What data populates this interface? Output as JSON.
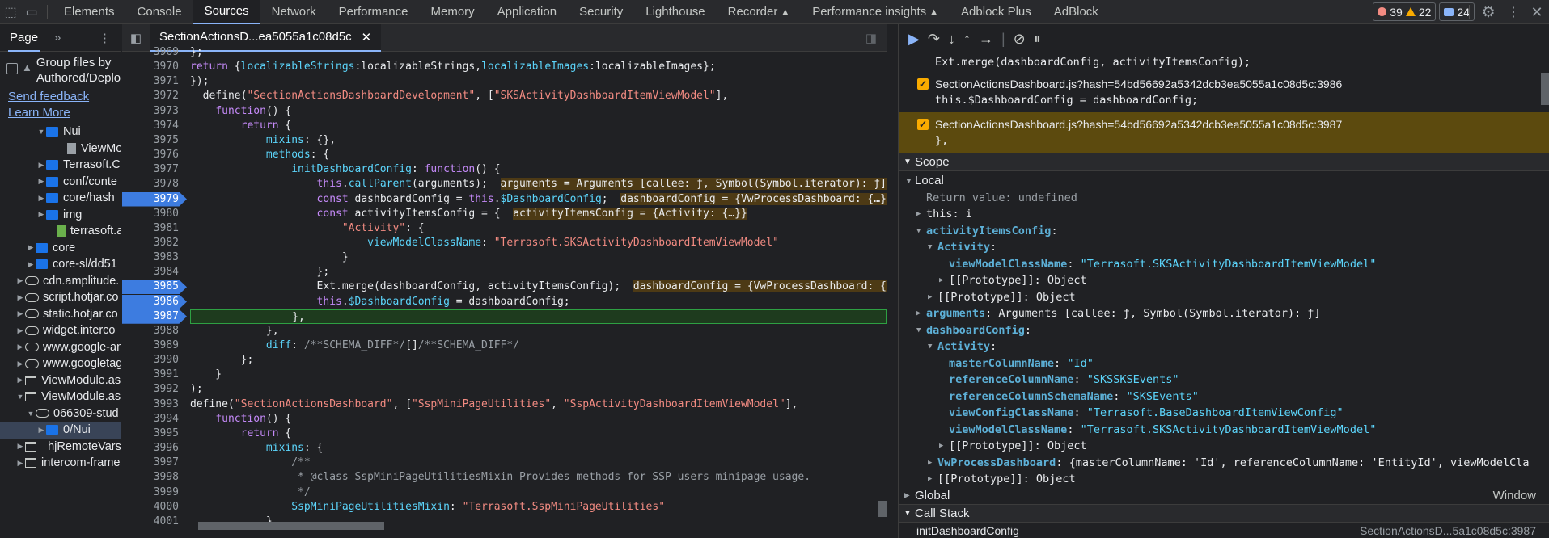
{
  "topbar": {
    "tabs": [
      "Elements",
      "Console",
      "Sources",
      "Network",
      "Performance",
      "Memory",
      "Application",
      "Security",
      "Lighthouse",
      "Recorder",
      "Performance insights",
      "Adblock Plus",
      "AdBlock"
    ],
    "active_tab": "Sources",
    "errors": "39",
    "warnings": "22",
    "messages": "24"
  },
  "left": {
    "tab": "Page",
    "group_label": "Group files by Authored/Deployed",
    "send_feedback": "Send feedback",
    "learn_more": "Learn More",
    "tree": [
      {
        "label": "Nui",
        "icon": "folder",
        "indent": 3,
        "arrow": "open"
      },
      {
        "label": "ViewModule.aspx",
        "icon": "file",
        "indent": 5,
        "arrow": ""
      },
      {
        "label": "Terrasoft.C",
        "icon": "folder",
        "indent": 3,
        "arrow": "closed"
      },
      {
        "label": "conf/conte",
        "icon": "folder",
        "indent": 3,
        "arrow": "closed"
      },
      {
        "label": "core/hash",
        "icon": "folder",
        "indent": 3,
        "arrow": "closed"
      },
      {
        "label": "img",
        "icon": "folder",
        "indent": 3,
        "arrow": "closed"
      },
      {
        "label": "terrasoft.a",
        "icon": "js",
        "indent": 4,
        "arrow": ""
      },
      {
        "label": "core",
        "icon": "folder",
        "indent": 2,
        "arrow": "closed"
      },
      {
        "label": "core-sl/dd51",
        "icon": "folder",
        "indent": 2,
        "arrow": "closed"
      },
      {
        "label": "cdn.amplitude.",
        "icon": "cloud",
        "indent": 1,
        "arrow": "closed"
      },
      {
        "label": "script.hotjar.co",
        "icon": "cloud",
        "indent": 1,
        "arrow": "closed"
      },
      {
        "label": "static.hotjar.co",
        "icon": "cloud",
        "indent": 1,
        "arrow": "closed"
      },
      {
        "label": "widget.interco",
        "icon": "cloud",
        "indent": 1,
        "arrow": "closed"
      },
      {
        "label": "www.google-an",
        "icon": "cloud",
        "indent": 1,
        "arrow": "closed"
      },
      {
        "label": "www.googletag",
        "icon": "cloud",
        "indent": 1,
        "arrow": "closed"
      },
      {
        "label": "ViewModule.as",
        "icon": "window",
        "indent": 1,
        "arrow": "closed"
      },
      {
        "label": "ViewModule.as",
        "icon": "window",
        "indent": 1,
        "arrow": "open"
      },
      {
        "label": "066309-stud",
        "icon": "cloud",
        "indent": 2,
        "arrow": "open"
      },
      {
        "label": "0/Nui",
        "icon": "folder",
        "indent": 3,
        "arrow": "closed",
        "selected": true
      },
      {
        "label": "_hjRemoteVarsF",
        "icon": "window",
        "indent": 1,
        "arrow": "closed"
      },
      {
        "label": "intercom-frame",
        "icon": "window",
        "indent": 1,
        "arrow": "closed"
      }
    ]
  },
  "editor": {
    "file_tab": "SectionActionsD...ea5055a1c08d5c",
    "lines": [
      {
        "n": "3969",
        "html": "};"
      },
      {
        "n": "3970",
        "html": "<span class='kw'>return</span> {<span class='p'>localizableStrings</span>:localizableStrings,<span class='p'>localizableImages</span>:localizableImages};"
      },
      {
        "n": "3971",
        "html": "});"
      },
      {
        "n": "3972",
        "html": "  define(<span class='s'>\"SectionActionsDashboardDevelopment\"</span>, [<span class='s'>\"SKSActivityDashboardItemViewModel\"</span>],"
      },
      {
        "n": "3973",
        "html": "    <span class='kw'>function</span>() {"
      },
      {
        "n": "3974",
        "html": "        <span class='kw'>return</span> {"
      },
      {
        "n": "3975",
        "html": "            <span class='p'>mixins</span>: {},"
      },
      {
        "n": "3976",
        "html": "            <span class='p'>methods</span>: {"
      },
      {
        "n": "3977",
        "html": "                <span class='p'>initDashboardConfig</span>: <span class='kw'>function</span>() {"
      },
      {
        "n": "3978",
        "html": "                    <span class='kw'>this</span>.<span class='p'>callParent</span>(arguments);  <span class='inl'>arguments = Arguments [callee: ƒ, Symbol(Symbol.iterator): ƒ]</span>"
      },
      {
        "n": "3979",
        "html": "                    <span class='kw'>const</span> dashboardConfig = <span class='kw'>this</span>.<span class='p'>$DashboardConfig</span>;  <span class='inl'>dashboardConfig = {VwProcessDashboard: {…}, Activity: {…}}</span>",
        "bp": true
      },
      {
        "n": "3980",
        "html": "                    <span class='kw'>const</span> activityItemsConfig = {  <span class='inl'>activityItemsConfig = {Activity: {…}}</span>"
      },
      {
        "n": "3981",
        "html": "                        <span class='s'>\"Activity\"</span>: {"
      },
      {
        "n": "3982",
        "html": "                            <span class='p'>viewModelClassName</span>: <span class='s'>\"Terrasoft.SKSActivityDashboardItemViewModel\"</span>"
      },
      {
        "n": "3983",
        "html": "                        }"
      },
      {
        "n": "3984",
        "html": "                    };"
      },
      {
        "n": "3985",
        "html": "                    Ext.merge(dashboardConfig, activityItemsConfig);  <span class='inl'>dashboardConfig = {VwProcessDashboard: {…}}</span>",
        "bp": true
      },
      {
        "n": "3986",
        "html": "                    <span class='kw'>this</span>.<span class='p'>$DashboardConfig</span> = dashboardConfig;",
        "bp": true
      },
      {
        "n": "3987",
        "html": "                },",
        "bp": true,
        "hl": true
      },
      {
        "n": "3988",
        "html": "            },"
      },
      {
        "n": "3989",
        "html": "            <span class='p'>diff</span>: <span class='c'>/**SCHEMA_DIFF*/</span>[]<span class='c'>/**SCHEMA_DIFF*/</span>"
      },
      {
        "n": "3990",
        "html": "        };"
      },
      {
        "n": "3991",
        "html": "    }"
      },
      {
        "n": "3992",
        "html": ");"
      },
      {
        "n": "3993",
        "html": "define(<span class='s'>\"SectionActionsDashboard\"</span>, [<span class='s'>\"SspMiniPageUtilities\"</span>, <span class='s'>\"SspActivityDashboardItemViewModel\"</span>],"
      },
      {
        "n": "3994",
        "html": "    <span class='kw'>function</span>() {"
      },
      {
        "n": "3995",
        "html": "        <span class='kw'>return</span> {"
      },
      {
        "n": "3996",
        "html": "            <span class='p'>mixins</span>: {"
      },
      {
        "n": "3997",
        "html": "                <span class='c'>/**</span>"
      },
      {
        "n": "3998",
        "html": "                <span class='c'> * @class SspMiniPageUtilitiesMixin Provides methods for SSP users minipage usage.</span>"
      },
      {
        "n": "3999",
        "html": "                <span class='c'> */</span>"
      },
      {
        "n": "4000",
        "html": "                <span class='p'>SspMiniPageUtilitiesMixin</span>: <span class='s'>\"Terrasoft.SspMiniPageUtilities\"</span>"
      },
      {
        "n": "4001",
        "html": "            }"
      }
    ]
  },
  "debugger": {
    "breakpoints": [
      {
        "code": "Ext.merge(dashboardConfig, activityItemsConfig);"
      },
      {
        "loc": "SectionActionsDashboard.js?hash=54bd56692a5342dcb3ea5055a1c08d5c:3986",
        "code": "this.$DashboardConfig = dashboardConfig;"
      },
      {
        "loc": "SectionActionsDashboard.js?hash=54bd56692a5342dcb3ea5055a1c08d5c:3987",
        "code": "},",
        "active": true
      }
    ],
    "scope_title": "Scope",
    "call_stack_title": "Call Stack",
    "call_stack_item": "initDashboardConfig",
    "call_stack_loc": "SectionActionsD...5a1c08d5c:3987",
    "global_label": "Global",
    "global_value": "Window",
    "scope": [
      {
        "d": 0,
        "a": "open",
        "html": "Local"
      },
      {
        "d": 1,
        "a": "",
        "html": "<span class='pn'>Return value: undefined</span>"
      },
      {
        "d": 1,
        "a": "closed",
        "html": "this: i"
      },
      {
        "d": 1,
        "a": "open",
        "html": "<span class='pk'>activityItemsConfig</span>:"
      },
      {
        "d": 2,
        "a": "open",
        "html": "<span class='pk'>Activity</span>:"
      },
      {
        "d": 3,
        "a": "",
        "html": "<span class='pk'>viewModelClassName</span>: <span class='sval'>\"Terrasoft.SKSActivityDashboardItemViewModel\"</span>"
      },
      {
        "d": 3,
        "a": "closed",
        "html": "[[Prototype]]: Object"
      },
      {
        "d": 2,
        "a": "closed",
        "html": "[[Prototype]]: Object"
      },
      {
        "d": 1,
        "a": "closed",
        "html": "<span class='pk'>arguments</span>: Arguments [callee: ƒ, Symbol(Symbol.iterator): ƒ]"
      },
      {
        "d": 1,
        "a": "open",
        "html": "<span class='pk'>dashboardConfig</span>:"
      },
      {
        "d": 2,
        "a": "open",
        "html": "<span class='pk'>Activity</span>:"
      },
      {
        "d": 3,
        "a": "",
        "html": "<span class='pk'>masterColumnName</span>: <span class='sval'>\"Id\"</span>"
      },
      {
        "d": 3,
        "a": "",
        "html": "<span class='pk'>referenceColumnName</span>: <span class='sval'>\"SKSSKSEvents\"</span>"
      },
      {
        "d": 3,
        "a": "",
        "html": "<span class='pk'>referenceColumnSchemaName</span>: <span class='sval'>\"SKSEvents\"</span>"
      },
      {
        "d": 3,
        "a": "",
        "html": "<span class='pk'>viewConfigClassName</span>: <span class='sval'>\"Terrasoft.BaseDashboardItemViewConfig\"</span>"
      },
      {
        "d": 3,
        "a": "",
        "html": "<span class='pk'>viewModelClassName</span>: <span class='sval'>\"Terrasoft.SKSActivityDashboardItemViewModel\"</span>"
      },
      {
        "d": 3,
        "a": "closed",
        "html": "[[Prototype]]: Object"
      },
      {
        "d": 2,
        "a": "closed",
        "html": "<span class='pk'>VwProcessDashboard</span>: {masterColumnName: 'Id', referenceColumnName: 'EntityId', viewModelCla"
      },
      {
        "d": 2,
        "a": "closed",
        "html": "[[Prototype]]: Object"
      }
    ]
  }
}
